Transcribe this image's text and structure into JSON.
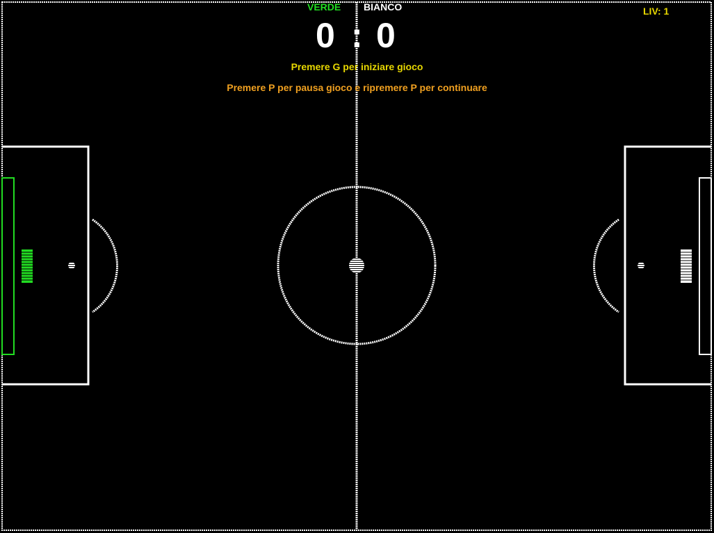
{
  "scoreboard": {
    "team_left": "VERDE",
    "team_right": "BIANCO",
    "score_left": "0",
    "separator": ":",
    "score_right": "0",
    "level": "LIV: 1"
  },
  "messages": {
    "start": "Premere G per iniziare gioco",
    "pause": "Premere P per pausa gioco e ripremere P per continuare"
  },
  "colors": {
    "background": "#000000",
    "lines": "#ffffff",
    "team_left": "#22dd22",
    "team_right": "#ffffff",
    "level": "#e8d800",
    "start_message": "#e8d800",
    "pause_message": "#f0a020",
    "score": "#ffffff"
  }
}
